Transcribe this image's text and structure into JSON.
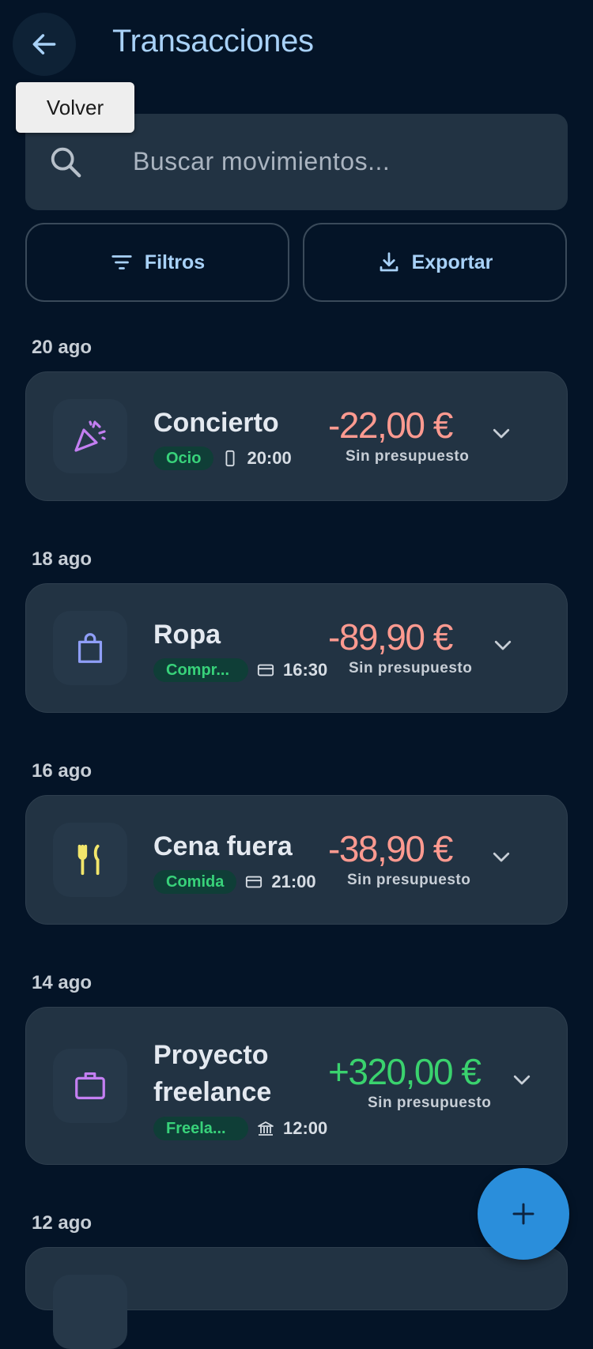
{
  "header": {
    "title": "Transacciones",
    "back_tooltip": "Volver"
  },
  "search": {
    "placeholder": "Buscar movimientos..."
  },
  "actions": {
    "filters_label": "Filtros",
    "export_label": "Exportar"
  },
  "groups": [
    {
      "date": "20 ago",
      "transaction": {
        "name": "Concierto",
        "category": "Ocio",
        "time": "20:00",
        "amount": "-22,00 €",
        "budget": "Sin presupuesto",
        "icon": "party-popper-icon",
        "payment_icon": "phone-icon"
      }
    },
    {
      "date": "18 ago",
      "transaction": {
        "name": "Ropa",
        "category": "Compr...",
        "time": "16:30",
        "amount": "-89,90 €",
        "budget": "Sin presupuesto",
        "icon": "shopping-bag-icon",
        "payment_icon": "card-icon"
      }
    },
    {
      "date": "16 ago",
      "transaction": {
        "name": "Cena fuera",
        "category": "Comida",
        "time": "21:00",
        "amount": "-38,90 €",
        "budget": "Sin presupuesto",
        "icon": "fork-knife-icon",
        "payment_icon": "card-icon"
      }
    },
    {
      "date": "14 ago",
      "transaction": {
        "name_line1": "Proyecto",
        "name_line2": "freelance",
        "category": "Freela...",
        "time": "12:00",
        "amount": "+320,00 €",
        "budget": "Sin presupuesto",
        "icon": "briefcase-icon",
        "payment_icon": "bank-icon"
      }
    },
    {
      "date": "12 ago"
    }
  ],
  "colors": {
    "background": "#041427",
    "card": "#223343",
    "accent": "#a8d1f7",
    "expense": "#ff9a90",
    "income": "#3ad26e",
    "chip_text": "#38d27a",
    "fab": "#2a8edb"
  },
  "fab": {
    "icon": "plus-icon"
  }
}
